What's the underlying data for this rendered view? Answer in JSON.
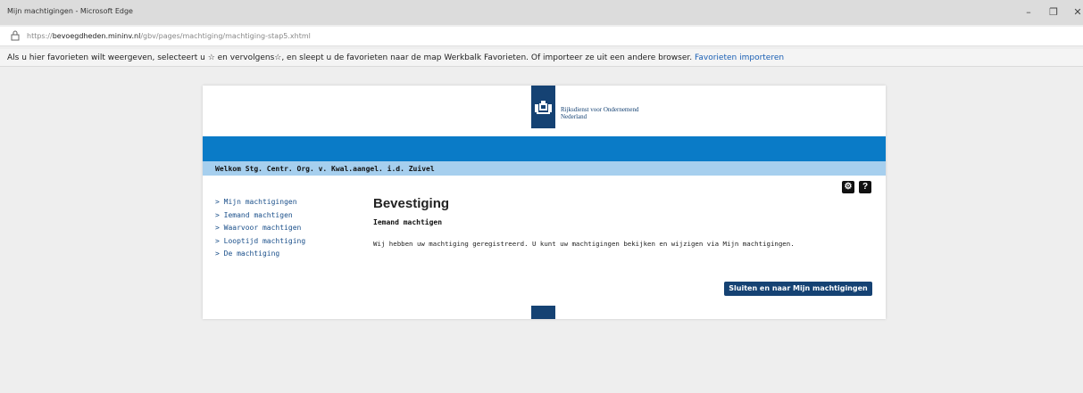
{
  "window": {
    "title": "Mijn machtigingen - Microsoft Edge",
    "minimize": "–",
    "restore": "❐",
    "close": "✕"
  },
  "address": {
    "scheme": "https://",
    "host": "bevoegdheden.mininv.nl",
    "path": "/gbv/pages/machtiging/machtiging-stap5.xhtml"
  },
  "favorites_bar": {
    "text": "Als u hier favorieten wilt weergeven, selecteert u ☆ en vervolgens☆, en sleept u de favorieten naar de map Werkbalk Favorieten. Of importeer ze uit een andere browser.",
    "link": "Favorieten importeren"
  },
  "header": {
    "org_line1": "Rijksdienst voor Ondernemend",
    "org_line2": "Nederland",
    "welcome": "Welkom Stg. Centr. Org. v. Kwal.aangel. i.d. Zuivel"
  },
  "toolbar": {
    "settings_symbol": "⚙",
    "help_symbol": "?"
  },
  "sidebar": {
    "items": [
      {
        "label": "> Mijn machtigingen"
      },
      {
        "label": "> Iemand machtigen"
      },
      {
        "label": "> Waarvoor machtigen"
      },
      {
        "label": "> Looptijd machtiging"
      },
      {
        "label": "> De machtiging"
      }
    ]
  },
  "main": {
    "title": "Bevestiging",
    "subtitle": "Iemand machtigen",
    "message": "Wij hebben uw machtiging geregistreerd. U kunt uw machtigingen bekijken en wijzigen via Mijn machtigingen.",
    "button": "Sluiten en naar Mijn machtigingen"
  }
}
